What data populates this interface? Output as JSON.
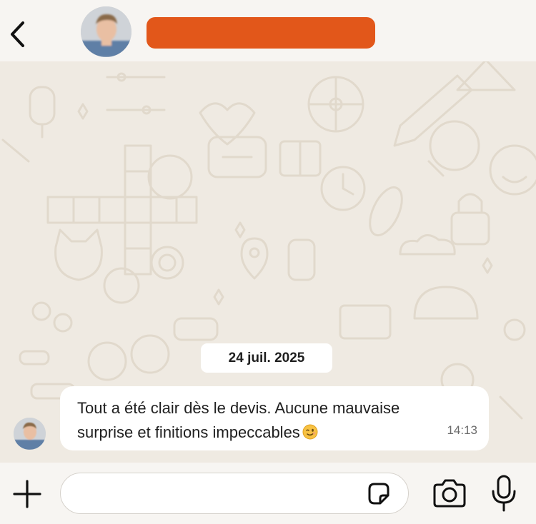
{
  "header": {
    "back_icon": "chevron-left-icon",
    "contact_name": "",
    "name_bar_color": "#e2571a"
  },
  "chat": {
    "date_separator": "24 juil. 2025",
    "messages": [
      {
        "text": "Tout a été clair dès le devis. Aucune mauvaise surprise et finitions impeccables",
        "emoji": "winking-face-emoji",
        "time": "14:13"
      }
    ],
    "background_color": "#efeae2"
  },
  "footer": {
    "input_placeholder": "",
    "icons": [
      "plus-icon",
      "sticker-icon",
      "camera-icon",
      "microphone-icon"
    ]
  }
}
